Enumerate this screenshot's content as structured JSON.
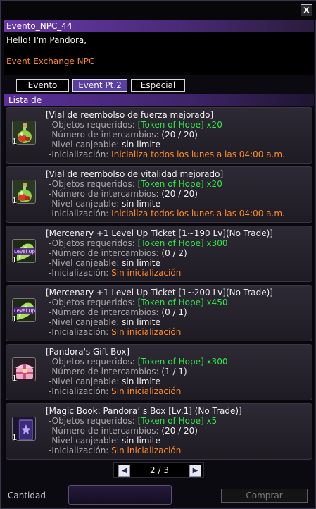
{
  "window": {
    "close_label": "x"
  },
  "npc": {
    "name": "Evento_NPC_44",
    "greeting": "Hello! I'm Pandora,",
    "role": "Event Exchange NPC"
  },
  "tabs": [
    {
      "label": "Evento",
      "active": false
    },
    {
      "label": "Event Pt.2",
      "active": true
    },
    {
      "label": "Especial",
      "active": false
    }
  ],
  "list": {
    "header": "Lista de",
    "labels": {
      "required": "-Objetos requeridos:",
      "exchanges": "-Número de intercambios:",
      "level": "-Nivel canjeable:",
      "reset": "-Inicialización:"
    },
    "items": [
      {
        "icon": "strength-vial-icon",
        "qty": "1",
        "title": "[Vial de reembolso de fuerza mejorado]",
        "required": "[Token of Hope] x20",
        "exchanges": "(20 / 20)",
        "level": "sin limite",
        "reset": "Inicializa todos los lunes a las 04:00 a.m."
      },
      {
        "icon": "vitality-vial-icon",
        "qty": "1",
        "title": "[Vial de reembolso de vitalidad mejorado]",
        "required": "[Token of Hope] x20",
        "exchanges": "(20 / 20)",
        "level": "sin limite",
        "reset": "Inicializa todos los lunes a las 04:00 a.m."
      },
      {
        "icon": "level-up-ticket-icon",
        "qty": "1",
        "title": "[Mercenary +1 Level Up Ticket [1~190 Lv](No Trade)]",
        "required": "[Token of Hope] x300",
        "exchanges": "(0 / 2)",
        "level": "sin limite",
        "reset": "Sin inicialización"
      },
      {
        "icon": "level-up-ticket-icon",
        "qty": "1",
        "title": "[Mercenary +1 Level Up Ticket [1~200 Lv](No Trade)]",
        "required": "[Token of Hope] x450",
        "exchanges": "(0 / 1)",
        "level": "sin limite",
        "reset": "Sin inicialización"
      },
      {
        "icon": "gift-box-icon",
        "qty": "1",
        "title": "[Pandora's Gift Box]",
        "required": "[Token of Hope] x300",
        "exchanges": "(1 / 1)",
        "level": "sin limite",
        "reset": "Sin inicialización"
      },
      {
        "icon": "magic-book-icon",
        "qty": "1",
        "title": "[Magic Book: Pandora’ s Box [Lv.1] (No Trade)]",
        "required": "[Token of Hope] x5",
        "exchanges": "(20 / 20)",
        "level": "sin limite",
        "reset": "Sin inicialización"
      }
    ]
  },
  "pager": {
    "text": "2 / 3",
    "prev_label": "◀",
    "next_label": "▶"
  },
  "footer": {
    "quantity_label": "Cantidad",
    "buy_label": "Comprar"
  },
  "colors": {
    "green": "#31e84a",
    "orange": "#ff8a2a",
    "accent": "#5a3fa0"
  }
}
